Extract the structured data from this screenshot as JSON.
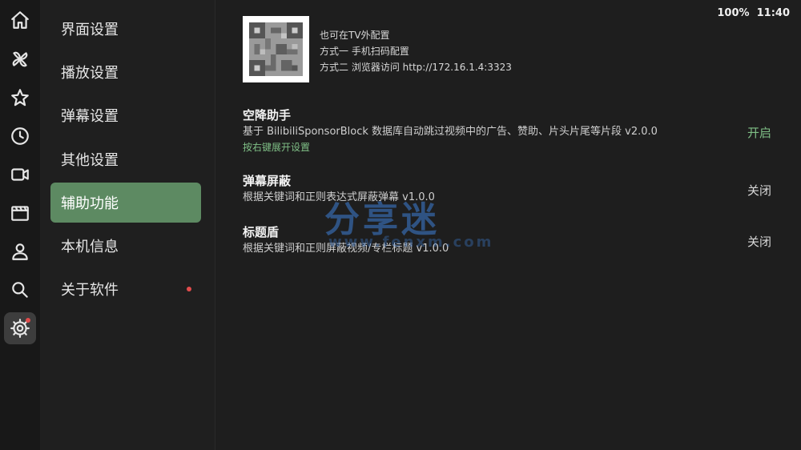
{
  "status": {
    "battery": "100%",
    "time": "11:40"
  },
  "rail": {
    "icons": [
      "home-icon",
      "pinwheel-icon",
      "star-icon",
      "clock-icon",
      "video-icon",
      "film-icon",
      "user-icon",
      "search-icon",
      "gear-icon"
    ]
  },
  "menu": {
    "items": [
      {
        "label": "界面设置"
      },
      {
        "label": "播放设置"
      },
      {
        "label": "弹幕设置"
      },
      {
        "label": "其他设置"
      },
      {
        "label": "辅助功能"
      },
      {
        "label": "本机信息"
      },
      {
        "label": "关于软件"
      }
    ],
    "active_index": 4,
    "accent": "#5d8a62",
    "badge_color": "#e24c4c"
  },
  "qr_info": {
    "line1": "也可在TV外配置",
    "line2": "方式一 手机扫码配置",
    "line3": "方式二 浏览器访问 http://172.16.1.4:3323"
  },
  "features": [
    {
      "title": "空降助手",
      "desc": "基于 BilibiliSponsorBlock 数据库自动跳过视频中的广告、赞助、片头片尾等片段  v2.0.0",
      "hint": "按右键展开设置",
      "state": "开启"
    },
    {
      "title": "弹幕屏蔽",
      "desc": "根据关键词和正则表达式屏蔽弹幕  v1.0.0",
      "state": "关闭"
    },
    {
      "title": "标题盾",
      "desc": "根据关键词和正则屏蔽视频/专栏标题  v1.0.0",
      "state": "关闭"
    }
  ],
  "watermark": {
    "text": "分享迷",
    "sub": "www.fenxm.com"
  }
}
